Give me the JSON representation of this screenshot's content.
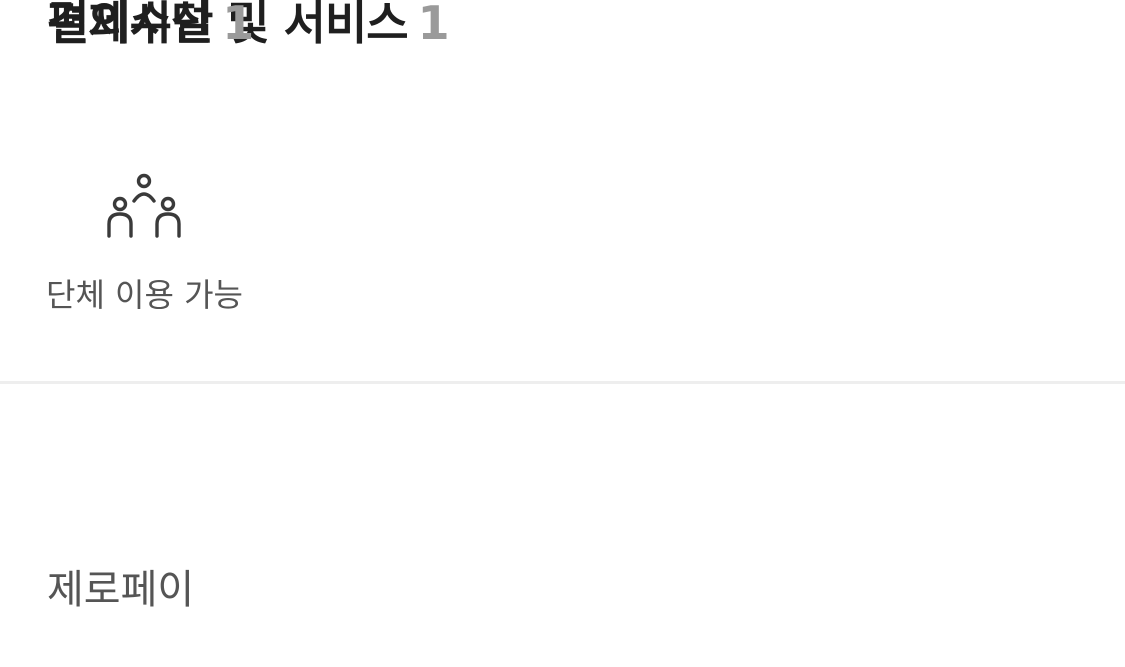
{
  "facilities": {
    "title": "편의시설 및 서비스",
    "count": "1",
    "items": [
      {
        "label": "단체 이용 가능",
        "icon": "group-icon"
      }
    ]
  },
  "payment": {
    "title": "결제수단",
    "count": "1",
    "items": [
      {
        "label": "제로페이"
      }
    ]
  }
}
